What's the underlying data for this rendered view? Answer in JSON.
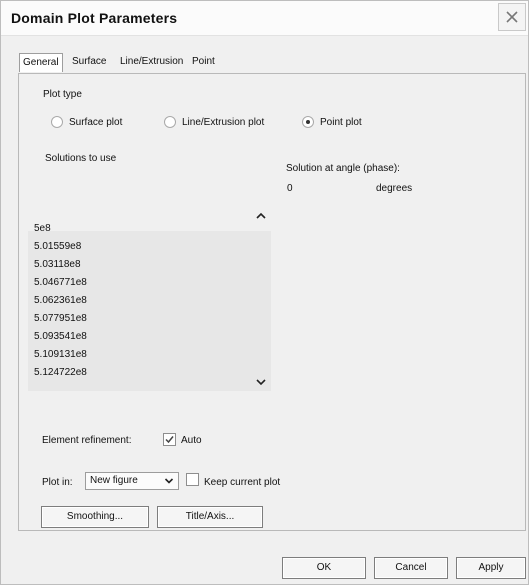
{
  "dialog": {
    "title": "Domain Plot Parameters",
    "close_icon": "close-icon"
  },
  "tabs": [
    {
      "label": "General",
      "active": true
    },
    {
      "label": "Surface",
      "active": false
    },
    {
      "label": "Line/Extrusion",
      "active": false
    },
    {
      "label": "Point",
      "active": false
    }
  ],
  "general": {
    "plot_type_label": "Plot type",
    "plot_types": [
      {
        "label": "Surface plot",
        "selected": false
      },
      {
        "label": "Line/Extrusion plot",
        "selected": false
      },
      {
        "label": "Point plot",
        "selected": true
      }
    ],
    "solutions_label": "Solutions to use",
    "solutions": [
      "5e8",
      "5.01559e8",
      "5.03118e8",
      "5.046771e8",
      "5.062361e8",
      "5.077951e8",
      "5.093541e8",
      "5.109131e8",
      "5.124722e8"
    ],
    "angle_label": "Solution at angle (phase):",
    "angle_value": "0",
    "angle_unit": "degrees",
    "element_refinement_label": "Element refinement:",
    "auto_label": "Auto",
    "auto_checked": true,
    "plot_in_label": "Plot in:",
    "plot_in_value": "New figure",
    "keep_current_plot_label": "Keep current plot",
    "keep_current_plot_checked": false,
    "smoothing_button": "Smoothing...",
    "title_axis_button": "Title/Axis..."
  },
  "footer": {
    "ok": "OK",
    "cancel": "Cancel",
    "apply": "Apply"
  }
}
